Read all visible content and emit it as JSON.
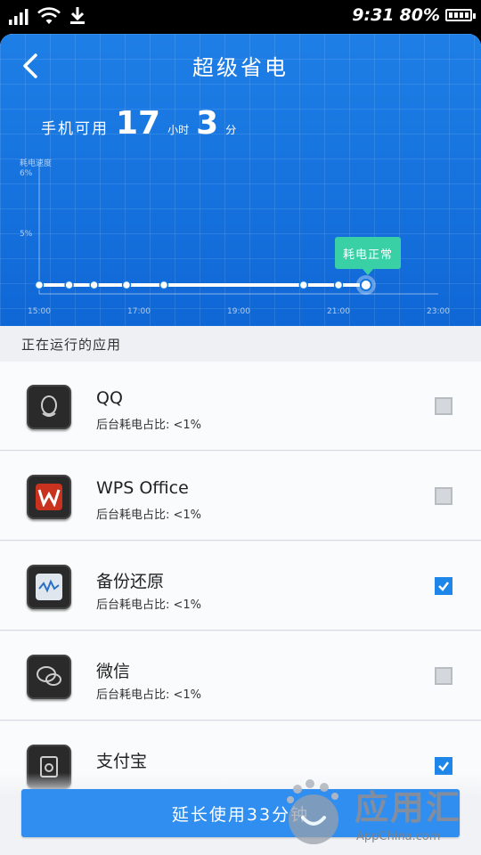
{
  "status_bar": {
    "time": "9:31",
    "battery": "80%"
  },
  "header": {
    "title": "超级省电"
  },
  "remaining": {
    "label": "手机可用",
    "hours": "17",
    "hours_unit": "小时",
    "minutes": "3",
    "minutes_unit": "分"
  },
  "chart_data": {
    "type": "line",
    "ylabel": "耗电速度",
    "yticks": [
      "6%",
      "5%"
    ],
    "xticks": [
      "15:00",
      "17:00",
      "19:00",
      "21:00",
      "23:00"
    ],
    "series": [
      {
        "x": [
          15.0,
          15.6,
          16.1,
          16.75,
          17.5,
          20.3,
          21.0,
          21.55
        ],
        "y": [
          0,
          0,
          0,
          0,
          0,
          0,
          0,
          0
        ]
      }
    ],
    "tooltip": "耗电正常",
    "ylim": [
      0,
      6
    ],
    "xlim": [
      15,
      23
    ]
  },
  "section_title": "正在运行的应用",
  "apps": [
    {
      "name": "QQ",
      "sub": "后台耗电占比: <1%",
      "checked": false,
      "icon": "qq-icon"
    },
    {
      "name": "WPS Office",
      "sub": "后台耗电占比: <1%",
      "checked": false,
      "icon": "wps-icon"
    },
    {
      "name": "备份还原",
      "sub": "后台耗电占比: <1%",
      "checked": true,
      "icon": "backup-icon"
    },
    {
      "name": "微信",
      "sub": "后台耗电占比: <1%",
      "checked": false,
      "icon": "wechat-icon"
    },
    {
      "name": "支付宝",
      "sub": "",
      "checked": true,
      "icon": "alipay-icon"
    }
  ],
  "extend_button": "延长使用33分钟",
  "watermark": {
    "text": "应用汇",
    "url": "AppChina.com"
  },
  "colors": {
    "hero": "#1477e0",
    "accent": "#2f8ef0",
    "tooltip": "#3ad0a6"
  }
}
